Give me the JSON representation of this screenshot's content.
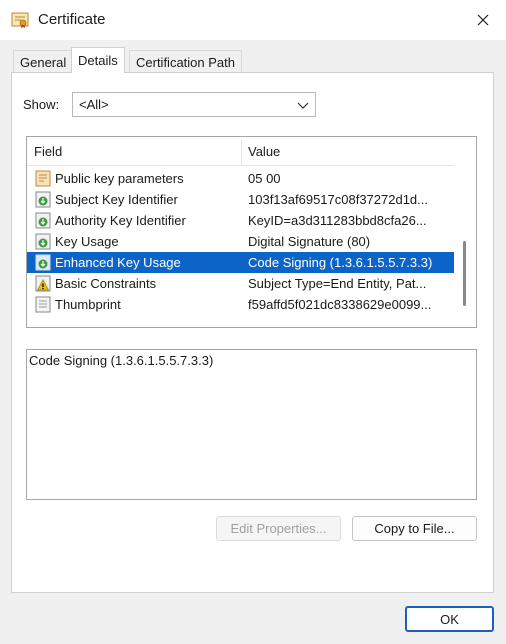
{
  "window": {
    "title": "Certificate"
  },
  "tabs": [
    {
      "label": "General",
      "active": false
    },
    {
      "label": "Details",
      "active": true
    },
    {
      "label": "Certification Path",
      "active": false
    }
  ],
  "show": {
    "label": "Show:",
    "value": "<All>"
  },
  "fields_table": {
    "columns": [
      "Field",
      "Value"
    ],
    "rows": [
      {
        "icon": "certificate-doc-icon",
        "field": "Public key parameters",
        "value": "05 00"
      },
      {
        "icon": "extension-download-icon",
        "field": "Subject Key Identifier",
        "value": "103f13af69517c08f37272d1d..."
      },
      {
        "icon": "extension-download-icon",
        "field": "Authority Key Identifier",
        "value": "KeyID=a3d311283bbd8cfa26..."
      },
      {
        "icon": "extension-download-icon",
        "field": "Key Usage",
        "value": "Digital Signature (80)"
      },
      {
        "icon": "extension-download-icon",
        "field": "Enhanced Key Usage",
        "value": "Code Signing (1.3.6.1.5.5.7.3.3)",
        "selected": true
      },
      {
        "icon": "critical-warning-icon",
        "field": "Basic Constraints",
        "value": "Subject Type=End Entity, Pat..."
      },
      {
        "icon": "document-icon",
        "field": "Thumbprint",
        "value": "f59affd5f021dc8338629e0099..."
      }
    ]
  },
  "detail_text": "Code Signing (1.3.6.1.5.5.7.3.3)",
  "buttons": {
    "edit_properties": "Edit Properties...",
    "copy_to_file": "Copy to File...",
    "ok": "OK"
  },
  "colors": {
    "selection": "#0c64c8",
    "ok_border": "#1d5fbf"
  }
}
